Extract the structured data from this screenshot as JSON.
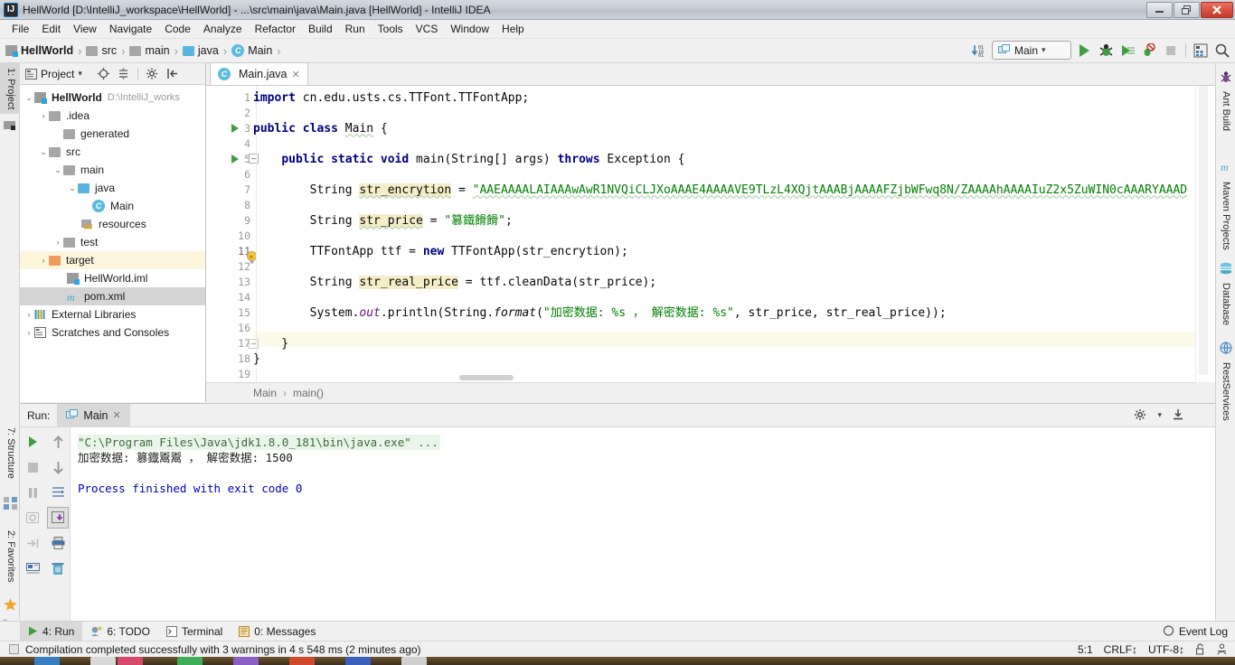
{
  "window": {
    "title": "HellWorld [D:\\IntelliJ_workspace\\HellWorld] - ...\\src\\main\\java\\Main.java [HellWorld] - IntelliJ IDEA",
    "app_icon": "intellij-logo-icon",
    "minimize": "—",
    "restore": "❐",
    "close": "✕"
  },
  "menu": {
    "items": [
      {
        "label": "File"
      },
      {
        "label": "Edit"
      },
      {
        "label": "View"
      },
      {
        "label": "Navigate"
      },
      {
        "label": "Code"
      },
      {
        "label": "Analyze"
      },
      {
        "label": "Refactor"
      },
      {
        "label": "Build"
      },
      {
        "label": "Run"
      },
      {
        "label": "Tools"
      },
      {
        "label": "VCS"
      },
      {
        "label": "Window"
      },
      {
        "label": "Help"
      }
    ]
  },
  "breadcrumb": {
    "items": [
      {
        "label": "HellWorld",
        "icon": "module-icon",
        "bold": true
      },
      {
        "label": "src",
        "icon": "folder-icon"
      },
      {
        "label": "main",
        "icon": "folder-icon"
      },
      {
        "label": "java",
        "icon": "folder-blue-icon"
      },
      {
        "label": "Main",
        "icon": "class-icon"
      }
    ],
    "separator": "›"
  },
  "toolbar": {
    "run_config": "Main",
    "run_config_caret": "▾",
    "buttons": [
      {
        "name": "compile-icon",
        "glyph": "↓"
      },
      {
        "name": "run-button",
        "glyph": "▶"
      },
      {
        "name": "debug-button",
        "glyph": "🐞"
      },
      {
        "name": "run-coverage-button",
        "glyph": "▶"
      },
      {
        "name": "attach-profiler-button",
        "glyph": "⊘"
      },
      {
        "name": "stop-button",
        "glyph": "■"
      },
      {
        "name": "database-button",
        "glyph": "▦"
      },
      {
        "name": "search-everywhere-button",
        "glyph": "🔍"
      }
    ]
  },
  "left_rail": {
    "tabs": [
      {
        "label": "1: Project",
        "active": true
      },
      {
        "label": "7: Structure",
        "active": false
      },
      {
        "label": "2: Favorites",
        "active": false
      }
    ]
  },
  "right_rail": {
    "tabs": [
      {
        "label": "Ant Build",
        "icon": "ant-icon"
      },
      {
        "label": "Maven Projects",
        "icon": "maven-m-icon"
      },
      {
        "label": "Database",
        "icon": "database-icon"
      },
      {
        "label": "RestServices",
        "icon": "rest-services-icon"
      }
    ]
  },
  "project_panel": {
    "header_label": "Project",
    "header_caret": "▾",
    "header_icons": [
      {
        "name": "project-view-icon",
        "glyph": "▤"
      },
      {
        "name": "locate-icon",
        "glyph": "☉"
      },
      {
        "name": "collapse-all-icon",
        "glyph": "≡"
      },
      {
        "name": "settings-gear-icon",
        "glyph": "⚙"
      },
      {
        "name": "hide-panel-icon",
        "glyph": "⇤"
      }
    ],
    "tree": [
      {
        "label": "HellWorld",
        "path": "D:\\IntelliJ_works",
        "depth": 0,
        "arrow": "⌄",
        "icon": "module-icon",
        "bold": true,
        "state": "normal"
      },
      {
        "label": ".idea",
        "depth": 1,
        "arrow": "›",
        "icon": "folder-icon",
        "state": "normal"
      },
      {
        "label": "generated",
        "depth": 2,
        "arrow": "",
        "icon": "folder-icon",
        "state": "normal"
      },
      {
        "label": "src",
        "depth": 1,
        "arrow": "⌄",
        "icon": "folder-icon",
        "state": "normal"
      },
      {
        "label": "main",
        "depth": 2,
        "arrow": "⌄",
        "icon": "folder-icon",
        "state": "normal"
      },
      {
        "label": "java",
        "depth": 3,
        "arrow": "⌄",
        "icon": "folder-blue-icon",
        "state": "normal"
      },
      {
        "label": "Main",
        "depth": 4,
        "arrow": "",
        "icon": "class-icon",
        "state": "normal"
      },
      {
        "label": "resources",
        "depth": 3,
        "arrow": "",
        "icon": "resources-folder-icon",
        "state": "normal"
      },
      {
        "label": "test",
        "depth": 2,
        "arrow": "›",
        "icon": "folder-icon",
        "state": "normal"
      },
      {
        "label": "target",
        "depth": 1,
        "arrow": "›",
        "icon": "folder-orange-icon",
        "state": "highlight"
      },
      {
        "label": "HellWorld.iml",
        "depth": 2,
        "arrow": "",
        "icon": "iml-file-icon",
        "state": "normal"
      },
      {
        "label": "pom.xml",
        "depth": 2,
        "arrow": "",
        "icon": "maven-m-icon",
        "state": "selected"
      },
      {
        "label": "External Libraries",
        "depth": 0,
        "arrow": "›",
        "icon": "libraries-icon",
        "state": "normal"
      },
      {
        "label": "Scratches and Consoles",
        "depth": 0,
        "arrow": "›",
        "icon": "scratches-icon",
        "state": "normal"
      }
    ]
  },
  "editor": {
    "tab": {
      "label": "Main.java",
      "icon": "class-icon",
      "close": "✕"
    },
    "current_line": 11,
    "line_count": 19,
    "breadcrumb": {
      "class": "Main",
      "method": "main()",
      "separator": "›"
    },
    "lines": [
      {
        "n": 1,
        "text": "import cn.edu.usts.cs.TTFont.TTFontApp;"
      },
      {
        "n": 2,
        "text": ""
      },
      {
        "n": 3,
        "text": "public class Main {"
      },
      {
        "n": 4,
        "text": ""
      },
      {
        "n": 5,
        "text": "    public static void main(String[] args) throws Exception {"
      },
      {
        "n": 6,
        "text": ""
      },
      {
        "n": 7,
        "text": "        String str_encrytion = \"AAEAAAALAIAAAwAwR1NVQiCLJXoAAAE4AAAAVE9TLzL4XQjtAAABjAAAAFZjbWFwq8N/ZAAAAhAAAAIuZ2x5ZuWIN0cAAARYAAAD"
      },
      {
        "n": 8,
        "text": ""
      },
      {
        "n": 9,
        "text": "        String str_price = \"篡鐡鬻鬻\";"
      },
      {
        "n": 10,
        "text": ""
      },
      {
        "n": 11,
        "text": "        TTFontApp ttf = new TTFontApp(str_encrytion);"
      },
      {
        "n": 12,
        "text": ""
      },
      {
        "n": 13,
        "text": "        String str_real_price = ttf.cleanData(str_price);"
      },
      {
        "n": 14,
        "text": ""
      },
      {
        "n": 15,
        "text": "        System.out.println(String.format(\"加密数据: %s ， 解密数据: %s\", str_price, str_real_price));"
      },
      {
        "n": 16,
        "text": ""
      },
      {
        "n": 17,
        "text": "    }"
      },
      {
        "n": 18,
        "text": "}"
      },
      {
        "n": 19,
        "text": ""
      }
    ],
    "gutter_icons": [
      {
        "line": 3,
        "name": "run-class-gutter-icon",
        "glyph": "▶"
      },
      {
        "line": 5,
        "name": "run-method-gutter-icon",
        "glyph": "▶"
      },
      {
        "line": 5,
        "name": "fold-region-icon",
        "glyph": "⊖"
      },
      {
        "line": 11,
        "name": "intention-bulb-icon",
        "glyph": "💡"
      },
      {
        "line": 17,
        "name": "fold-region-icon",
        "glyph": "⊖"
      }
    ]
  },
  "run_panel": {
    "label": "Run:",
    "tab": {
      "label": "Main",
      "icon": "run-config-icon",
      "close": "✕"
    },
    "header_icons": [
      {
        "name": "settings-gear-icon",
        "glyph": "⚙"
      },
      {
        "name": "pin-tab-icon",
        "glyph": "⊥"
      }
    ],
    "tools": [
      {
        "name": "rerun-button",
        "glyph": "▶"
      },
      {
        "name": "stop-button",
        "glyph": "■"
      },
      {
        "name": "pause-output-button",
        "glyph": "‖"
      },
      {
        "name": "dump-threads-button",
        "glyph": "◎"
      },
      {
        "name": "restore-layout-button",
        "glyph": "⇥"
      },
      {
        "name": "toggle-console-button",
        "glyph": "▣"
      },
      {
        "name": "scroll-up-button",
        "glyph": "↑"
      },
      {
        "name": "scroll-down-button",
        "glyph": "↓"
      },
      {
        "name": "soft-wrap-button",
        "glyph": "↵"
      },
      {
        "name": "scroll-to-end-button",
        "glyph": "⇩"
      },
      {
        "name": "print-button",
        "glyph": "⎙"
      },
      {
        "name": "clear-all-button",
        "glyph": "🗑"
      }
    ],
    "console_lines": [
      {
        "text": "\"C:\\Program Files\\Java\\jdk1.8.0_181\\bin\\java.exe\" ...",
        "kind": "cmd"
      },
      {
        "text": "加密数据: 篡鐡鬻鬻 ， 解密数据: 1500",
        "kind": "out"
      },
      {
        "text": "",
        "kind": "out"
      },
      {
        "text": "Process finished with exit code 0",
        "kind": "fin"
      }
    ]
  },
  "bottom_bar": {
    "tabs": [
      {
        "label": "4: Run",
        "icon": "run-icon",
        "active": true
      },
      {
        "label": "6: TODO",
        "icon": "todo-icon",
        "active": false
      },
      {
        "label": "Terminal",
        "icon": "terminal-icon",
        "active": false
      },
      {
        "label": "0: Messages",
        "icon": "messages-icon",
        "active": false
      }
    ],
    "event_log": {
      "label": "Event Log",
      "icon": "event-log-icon"
    }
  },
  "status_bar": {
    "message": "Compilation completed successfully with 3 warnings in 4 s 548 ms (2 minutes ago)",
    "caret_position": "5:1",
    "line_separator": "CRLF↕",
    "encoding": "UTF-8↕",
    "lock_icon": "read-only-lock-icon",
    "inspections_icon": "inspections-icon"
  },
  "colors": {
    "keyword": "#000080",
    "string": "#008000",
    "field_highlight": "#f5ecc8",
    "static_italic": "#660e7a",
    "current_line": "#fcfae8",
    "console_finished": "#0000c0",
    "accent_blue": "#2ca6de"
  }
}
